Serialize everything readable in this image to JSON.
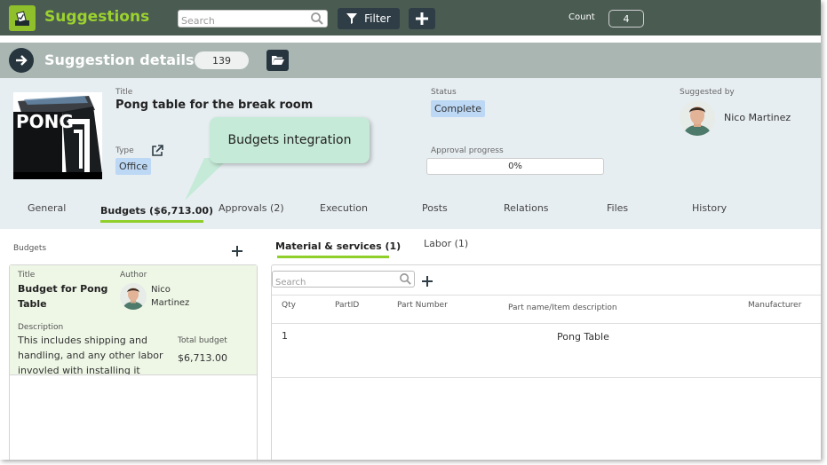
{
  "app": {
    "title": "Suggestions",
    "logo_icon": "ballot-box-icon",
    "brand_color": "#9bd22e"
  },
  "search": {
    "placeholder": "Search"
  },
  "toolbar": {
    "filter_label": "Filter",
    "count_label": "Count",
    "count_value": "4"
  },
  "details": {
    "title": "Suggestion details",
    "id": "139"
  },
  "suggestion": {
    "title_label": "Title",
    "title": "Pong table for the break room",
    "type_label": "Type",
    "type": "Office",
    "status_label": "Status",
    "status": "Complete",
    "approval_label": "Approval progress",
    "approval_progress": "0%",
    "suggested_by_label": "Suggested by",
    "suggested_by": "Nico Martinez"
  },
  "callout": {
    "text": "Budgets integration"
  },
  "tabs": [
    {
      "label": "General"
    },
    {
      "label": "Budgets ($6,713.00)"
    },
    {
      "label": "Approvals (2)"
    },
    {
      "label": "Execution"
    },
    {
      "label": "Posts"
    },
    {
      "label": "Relations"
    },
    {
      "label": "Files"
    },
    {
      "label": "History"
    }
  ],
  "budgets": {
    "section_label": "Budgets",
    "card": {
      "title_label": "Title",
      "title": "Budget for Pong Table",
      "author_label": "Author",
      "author": "Nico Martinez",
      "description_label": "Description",
      "description": "This includes shipping and handling, and any other labor invovled with installing it",
      "total_label": "Total budget",
      "total": "$6,713.00"
    }
  },
  "materials": {
    "tabs": [
      {
        "label": "Material & services (1)"
      },
      {
        "label": "Labor (1)"
      }
    ],
    "search_placeholder": "Search",
    "columns": [
      "Qty",
      "PartID",
      "Part Number",
      "Part name/Item description",
      "Manufacturer"
    ],
    "rows": [
      {
        "qty": "1",
        "part_id": "",
        "part_number": "",
        "description": "Pong Table",
        "manufacturer": ""
      }
    ]
  },
  "colors": {
    "topbar": "#4a5b52",
    "details_bar": "#a9b6b2",
    "accent": "#8fcf2a",
    "badge": "#bcd8f5",
    "callout": "#c6ead8"
  }
}
